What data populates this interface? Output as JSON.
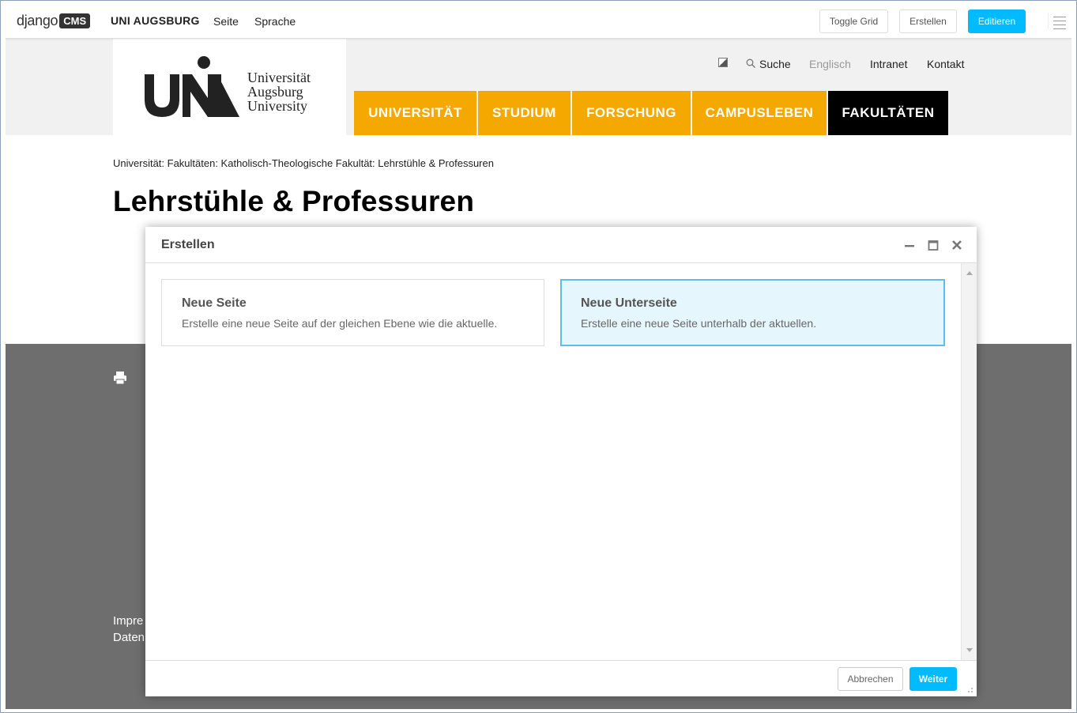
{
  "toolbar": {
    "logo_text": "django",
    "logo_badge": "CMS",
    "site_name": "UNI AUGSBURG",
    "menu_page": "Seite",
    "menu_language": "Sprache",
    "toggle_grid": "Toggle Grid",
    "create": "Erstellen",
    "edit": "Editieren",
    "menu_icon": "hamburger-icon"
  },
  "header": {
    "logo_lines": [
      "Universität",
      "Augsburg",
      "University"
    ],
    "meta": {
      "contrast_icon": "contrast-icon",
      "search_icon": "search-icon",
      "search": "Suche",
      "language": "Englisch",
      "intranet": "Intranet",
      "contact": "Kontakt"
    },
    "nav": [
      {
        "label": "UNIVERSITÄT",
        "active": false
      },
      {
        "label": "STUDIUM",
        "active": false
      },
      {
        "label": "FORSCHUNG",
        "active": false
      },
      {
        "label": "CAMPUSLEBEN",
        "active": false
      },
      {
        "label": "FAKULTÄTEN",
        "active": true
      }
    ],
    "colors": {
      "nav": "#f5a800",
      "nav_active": "#000000"
    }
  },
  "page": {
    "breadcrumb": "Universität: Fakultäten: Katholisch-Theologische Fakultät: Lehrstühle & Professuren",
    "title": "Lehrstühle & Professuren"
  },
  "footer": {
    "print_icon": "print-icon",
    "link1": "Impre",
    "link2": "Daten"
  },
  "modal": {
    "title": "Erstellen",
    "icons": [
      "minimize-icon",
      "maximize-icon",
      "close-icon"
    ],
    "options": [
      {
        "title": "Neue Seite",
        "desc": "Erstelle eine neue Seite auf der gleichen Ebene wie die aktuelle.",
        "selected": false
      },
      {
        "title": "Neue Unterseite",
        "desc": "Erstelle eine neue Seite unterhalb der aktuellen.",
        "selected": true
      }
    ],
    "cancel": "Abbrechen",
    "next": "Weiter",
    "accent": "#00bbff"
  }
}
